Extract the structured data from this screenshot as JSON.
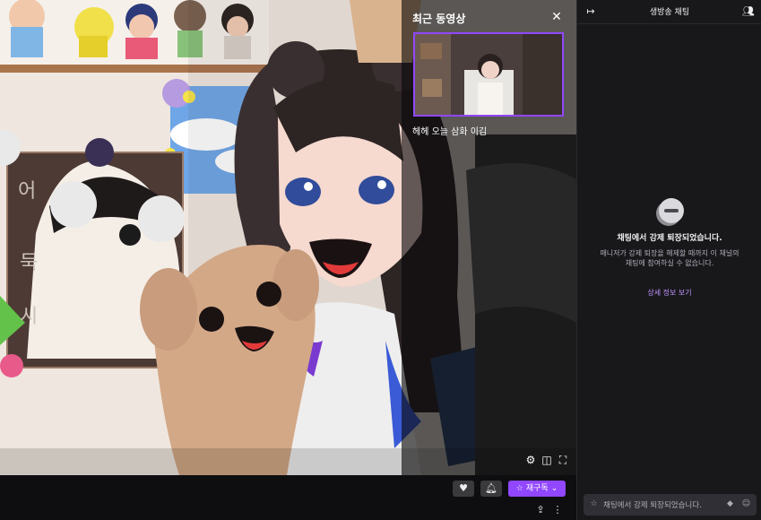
{
  "recent_videos": {
    "title": "최근 동영상",
    "close_icon": "close-icon",
    "items": [
      {
        "caption": "헤헤 오늘 삼화 이김"
      }
    ]
  },
  "player_controls": {
    "icons": [
      "gear-icon",
      "theatre-mode-icon",
      "fullscreen-icon"
    ]
  },
  "action_bar": {
    "follow_icon": "heart-icon",
    "notify_icon": "bell-icon",
    "resub_label": "재구독",
    "resub_icon": "star-icon",
    "resub_chevron": "chevron-down-icon",
    "share_icon": "share-icon",
    "more_icon": "more-vertical-icon"
  },
  "chat": {
    "title": "생방송 채팅",
    "collapse_icon": "collapse-arrow-icon",
    "users_icon": "users-icon",
    "banned_title": "채팅에서 강제 퇴장되었습니다.",
    "banned_description": "매니저가 강제 퇴장을 해제할 때까지 이 채널의 채팅에 참여하실 수 없습니다.",
    "details_link": "상세 정보 보기",
    "input_placeholder": "채팅에서 강제 퇴장되었습니다.",
    "accent": "#9147ff"
  }
}
